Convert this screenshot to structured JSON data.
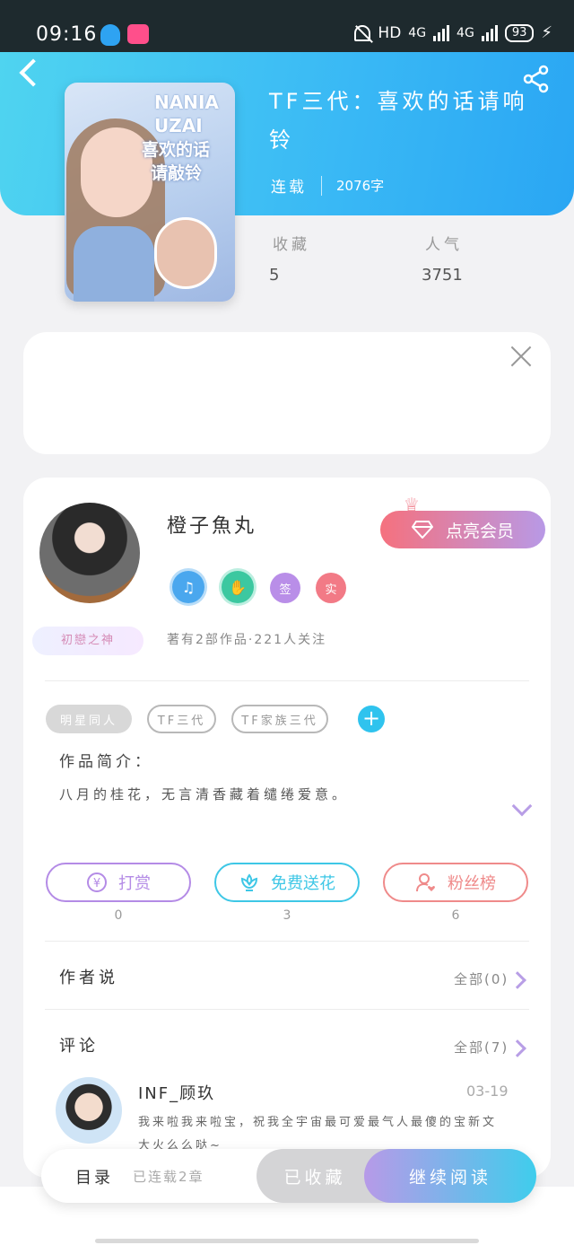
{
  "status_bar": {
    "time": "09:16",
    "hd": "HD",
    "network1": "4G",
    "network2": "4G",
    "battery": "93"
  },
  "book": {
    "title": "TF三代：喜欢的话请响铃",
    "status": "连载",
    "word_count": "2076字",
    "cover_text_1": "NANIA",
    "cover_text_2": "UZAI",
    "cover_text_3": "喜欢的话",
    "cover_text_4": "请敲铃"
  },
  "stats": {
    "favorites_label": "收藏",
    "favorites_value": "5",
    "popularity_label": "人气",
    "popularity_value": "3751"
  },
  "author": {
    "name": "橙子魚丸",
    "badge_title": "初戀之神",
    "vip_label": "点亮会员",
    "badge_sign": "签",
    "badge_real": "实",
    "works_info": "著有2部作品·221人关注"
  },
  "tags": [
    "明星同人",
    "TF三代",
    "TF家族三代"
  ],
  "intro": {
    "label": "作品简介：",
    "text": "八月的桂花，无言清香藏着缱绻爱意。"
  },
  "actions": [
    {
      "label": "打赏",
      "count": "0",
      "color": "#b48be6"
    },
    {
      "label": "免费送花",
      "count": "3",
      "color": "#3ec7e6"
    },
    {
      "label": "粉丝榜",
      "count": "6",
      "color": "#ef8a8a"
    }
  ],
  "author_says": {
    "title": "作者说",
    "all": "全部(0)"
  },
  "comments": {
    "title": "评论",
    "all": "全部(7)",
    "items": [
      {
        "name": "INF_顾玖",
        "date": "03-19",
        "text": "我来啦我来啦宝，祝我全宇宙最可爱最气人最傻的宝新文大火么么哒~"
      }
    ]
  },
  "bottom": {
    "toc": "目录",
    "chapters": "已连载2章",
    "saved": "已收藏",
    "read": "继续阅读"
  },
  "colors": {
    "header_start": "#4fd4f0",
    "header_end": "#2aa6f3",
    "vip_start": "#f5717e",
    "vip_end": "#b899e6"
  }
}
